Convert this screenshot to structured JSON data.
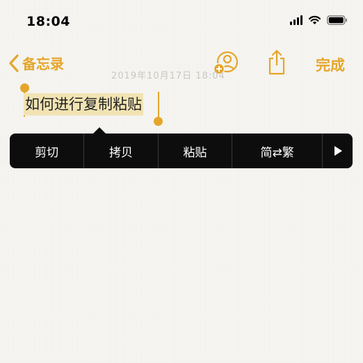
{
  "status_bar": {
    "time": "18:04",
    "icons": [
      "signal-icon",
      "wifi-icon",
      "battery-icon"
    ]
  },
  "nav": {
    "back_label": "备忘录",
    "share_icon": "share-icon",
    "collab_icon": "add-person-icon",
    "done_label": "完成"
  },
  "note": {
    "date": "2019年10月17日 18:04",
    "selected_text": "如何进行复制粘贴"
  },
  "edit_menu": {
    "items": [
      "剪切",
      "拷贝",
      "粘贴",
      "简⇄繁"
    ],
    "more_icon": "play-right-icon"
  },
  "colors": {
    "accent": "#e4a62a",
    "menu_bg": "#0d0d0d",
    "selection": "#f1e3b3",
    "background": "#f6f5f1"
  }
}
